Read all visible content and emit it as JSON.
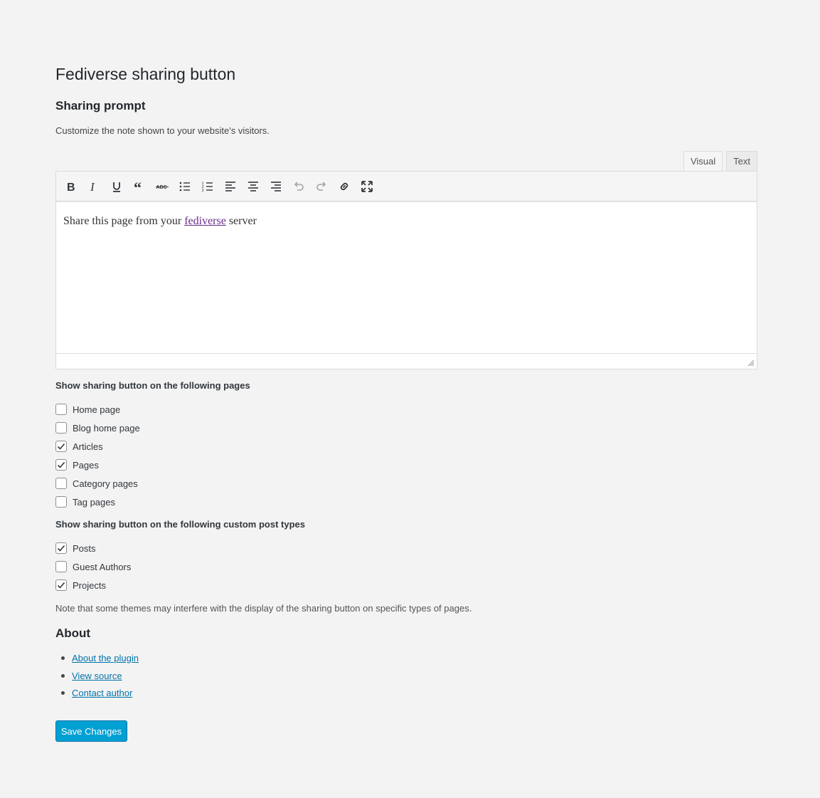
{
  "page_title": "Fediverse sharing button",
  "sharing_prompt": {
    "heading": "Sharing prompt",
    "description": "Customize the note shown to your website's visitors."
  },
  "editor": {
    "tabs": {
      "visual": "Visual",
      "text": "Text"
    },
    "toolbar_icons": [
      "bold-icon",
      "italic-icon",
      "underline-icon",
      "blockquote-icon",
      "strikethrough-icon",
      "bulleted-list-icon",
      "numbered-list-icon",
      "align-left-icon",
      "align-center-icon",
      "align-right-icon",
      "undo-icon",
      "redo-icon",
      "link-icon",
      "fullscreen-icon"
    ],
    "content_before": "Share this page from your ",
    "content_link": "fediverse",
    "content_after": " server"
  },
  "pages": {
    "heading": "Show sharing button on the following pages",
    "items": [
      {
        "label": "Home page",
        "checked": false
      },
      {
        "label": "Blog home page",
        "checked": false
      },
      {
        "label": "Articles",
        "checked": true
      },
      {
        "label": "Pages",
        "checked": true
      },
      {
        "label": "Category pages",
        "checked": false
      },
      {
        "label": "Tag pages",
        "checked": false
      }
    ]
  },
  "custom_types": {
    "heading": "Show sharing button on the following custom post types",
    "items": [
      {
        "label": "Posts",
        "checked": true
      },
      {
        "label": "Guest Authors",
        "checked": false
      },
      {
        "label": "Projects",
        "checked": true
      }
    ]
  },
  "note": "Note that some themes may interfere with the display of the sharing button on specific types of pages.",
  "about": {
    "heading": "About",
    "links": [
      "About the plugin",
      "View source",
      "Contact author"
    ]
  },
  "save_label": "Save Changes",
  "colors": {
    "accent": "#00a0d2",
    "link": "#0073aa",
    "visited_link": "#6a2b8a"
  }
}
